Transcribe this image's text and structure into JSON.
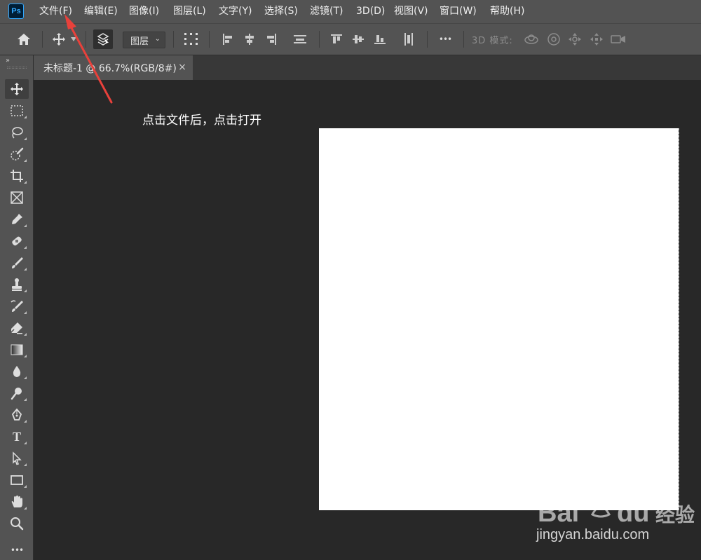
{
  "app": {
    "logo_text": "Ps"
  },
  "menu": [
    {
      "label": "文件(F)"
    },
    {
      "label": "编辑(E)"
    },
    {
      "label": "图像(I)"
    },
    {
      "label": "图层(L)"
    },
    {
      "label": "文字(Y)"
    },
    {
      "label": "选择(S)"
    },
    {
      "label": "滤镜(T)"
    },
    {
      "label": "3D(D)"
    },
    {
      "label": "视图(V)"
    },
    {
      "label": "窗口(W)"
    },
    {
      "label": "帮助(H)"
    }
  ],
  "options_bar": {
    "auto_select_value": "图层",
    "more_label": "•••",
    "mode_3d_label": "3D 模式:"
  },
  "document_tab": {
    "title": "未标题-1 @ 66.7%(RGB/8#)",
    "close_glyph": "×"
  },
  "toolbar": {
    "collapse_glyph": "››",
    "text_tool_glyph": "T",
    "more_tools_glyph": "•••",
    "tools": [
      "move-tool",
      "marquee-tool",
      "lasso-tool",
      "quick-selection-tool",
      "crop-tool",
      "frame-tool",
      "eyedropper-tool",
      "healing-brush-tool",
      "brush-tool",
      "clone-stamp-tool",
      "history-brush-tool",
      "eraser-tool",
      "gradient-tool",
      "blur-tool",
      "dodge-tool",
      "pen-tool",
      "text-tool",
      "path-selection-tool",
      "rectangle-tool",
      "hand-tool",
      "zoom-tool",
      "edit-toolbar"
    ]
  },
  "annotation": {
    "text": "点击文件后，点击打开",
    "arrow_color": "#e8413b"
  },
  "watermark": {
    "url": "jingyan.baidu.com"
  },
  "colors": {
    "menu_bg": "#535353",
    "workspace_bg": "#282828",
    "canvas_bg": "#ffffff",
    "ps_blue": "#31a8ff"
  }
}
